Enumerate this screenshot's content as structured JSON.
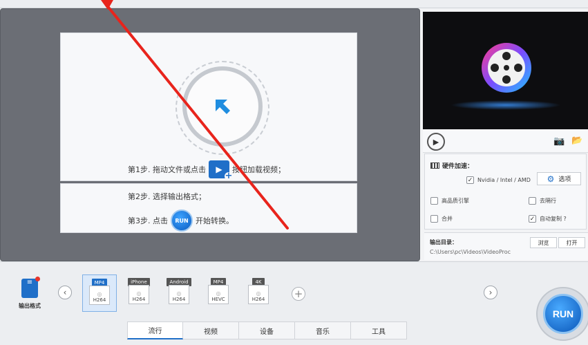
{
  "drop": {
    "step1_prefix": "第1步. 拖动文件或点击",
    "step1_suffix": "按钮加载视频；",
    "step2": "第2步. 选择输出格式；",
    "step3_prefix": "第3步. 点击",
    "step3_suffix": "开始转换。",
    "run_mini_label": "RUN"
  },
  "options": {
    "hw_title": "硬件加速：",
    "hw_check": "Nvidia / Intel / AMD",
    "options_btn": "选项",
    "high_quality": "高品质引擎",
    "deinterlace": "去隔行",
    "merge": "合并",
    "auto_copy": "自动复制 ?"
  },
  "output": {
    "label": "输出目录：",
    "path": "C:\\Users\\pc\\Videos\\VideoProc",
    "browse": "浏览",
    "open": "打开"
  },
  "bottom": {
    "format_out_label": "输出格式",
    "formats": [
      {
        "tag": "MP4",
        "codec": "H264"
      },
      {
        "tag": "iPhone",
        "codec": "H264"
      },
      {
        "tag": "Android",
        "codec": "H264"
      },
      {
        "tag": "MP4",
        "codec": "HEVC"
      },
      {
        "tag": "4K",
        "codec": "H264"
      }
    ],
    "tabs": [
      "流行",
      "视频",
      "设备",
      "音乐",
      "工具"
    ],
    "run_label": "RUN"
  },
  "colors": {
    "accent": "#1f6fc8",
    "annotation_arrow": "#e8241c"
  },
  "icons": [
    "add-video-icon",
    "camera-icon",
    "folder-icon",
    "gear-icon",
    "play-icon",
    "hardware-icon"
  ]
}
